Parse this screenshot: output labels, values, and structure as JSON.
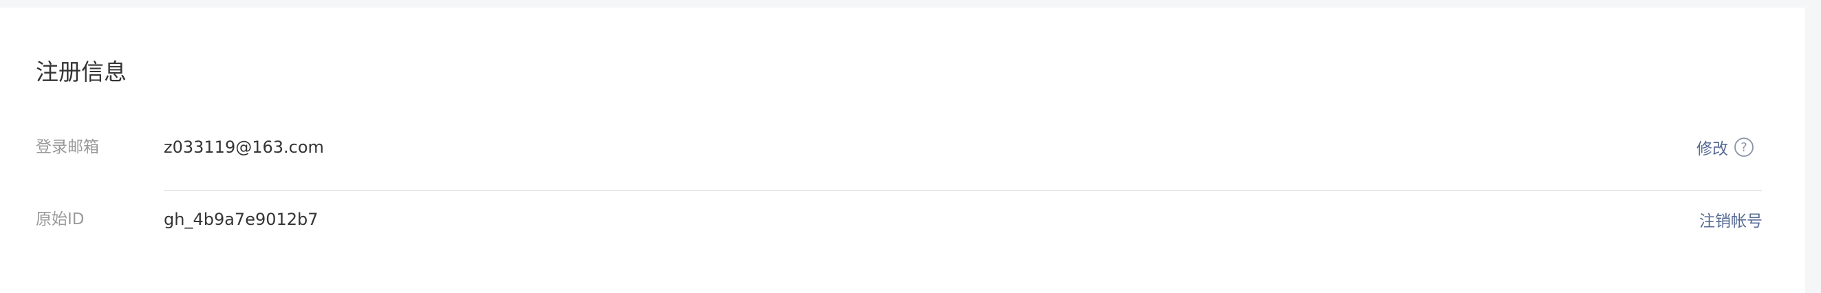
{
  "section": {
    "title": "注册信息"
  },
  "rows": [
    {
      "label": "登录邮箱",
      "value": "z033119@163.com",
      "action": "修改",
      "action_icon": "question-circle-icon"
    },
    {
      "label": "原始ID",
      "value": "gh_4b9a7e9012b7",
      "action": "注销帐号"
    }
  ],
  "colors": {
    "link": "#576b95",
    "text": "#353535",
    "label": "#9a9a9a",
    "divider": "#e7e7eb",
    "page_bg": "#f5f6f7"
  }
}
